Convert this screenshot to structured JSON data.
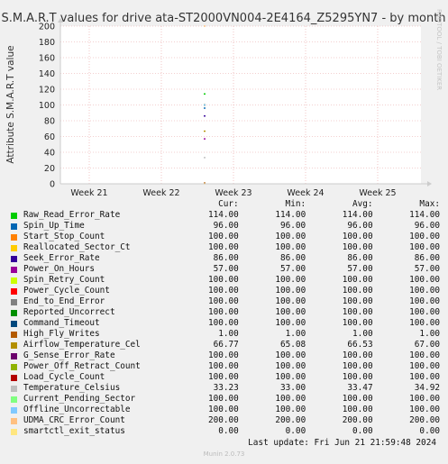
{
  "chart_data": {
    "type": "line",
    "title": "S.M.A.R.T values for drive ata-ST2000VN004-2E4164_Z5295YN7 - by month",
    "ylabel": "Attribute S.M.A.R.T value",
    "ylim": [
      0,
      200
    ],
    "yticks": [
      "0",
      "20",
      "40",
      "60",
      "80",
      "100",
      "120",
      "140",
      "160",
      "180",
      "200"
    ],
    "xlim": [
      20.6,
      25.6
    ],
    "xticks": [
      {
        "x": 21,
        "label": "Week 21"
      },
      {
        "x": 22,
        "label": "Week 22"
      },
      {
        "x": 23,
        "label": "Week 23"
      },
      {
        "x": 24,
        "label": "Week 24"
      },
      {
        "x": 25,
        "label": "Week 25"
      }
    ],
    "data_x": 22.6,
    "grid": true,
    "legend_position": "bottom",
    "side_label": "RRDTOOL / TOBI OETIKER",
    "columns": {
      "cur": "Cur:",
      "min": "Min:",
      "avg": "Avg:",
      "max": "Max:"
    },
    "series": [
      {
        "name": "Raw_Read_Error_Rate",
        "color": "#00cc00",
        "cur": "114.00",
        "min": "114.00",
        "avg": "114.00",
        "max": "114.00",
        "value": 114
      },
      {
        "name": "Spin_Up_Time",
        "color": "#0066b3",
        "cur": "96.00",
        "min": "96.00",
        "avg": "96.00",
        "max": "96.00",
        "value": 96
      },
      {
        "name": "Start_Stop_Count",
        "color": "#ff8000",
        "cur": "100.00",
        "min": "100.00",
        "avg": "100.00",
        "max": "100.00",
        "value": 100
      },
      {
        "name": "Reallocated_Sector_Ct",
        "color": "#ffcc00",
        "cur": "100.00",
        "min": "100.00",
        "avg": "100.00",
        "max": "100.00",
        "value": 100
      },
      {
        "name": "Seek_Error_Rate",
        "color": "#330099",
        "cur": "86.00",
        "min": "86.00",
        "avg": "86.00",
        "max": "86.00",
        "value": 86
      },
      {
        "name": "Power_On_Hours",
        "color": "#990099",
        "cur": "57.00",
        "min": "57.00",
        "avg": "57.00",
        "max": "57.00",
        "value": 57
      },
      {
        "name": "Spin_Retry_Count",
        "color": "#ccff00",
        "cur": "100.00",
        "min": "100.00",
        "avg": "100.00",
        "max": "100.00",
        "value": 100
      },
      {
        "name": "Power_Cycle_Count",
        "color": "#ff0000",
        "cur": "100.00",
        "min": "100.00",
        "avg": "100.00",
        "max": "100.00",
        "value": 100
      },
      {
        "name": "End_to_End_Error",
        "color": "#808080",
        "cur": "100.00",
        "min": "100.00",
        "avg": "100.00",
        "max": "100.00",
        "value": 100
      },
      {
        "name": "Reported_Uncorrect",
        "color": "#008f00",
        "cur": "100.00",
        "min": "100.00",
        "avg": "100.00",
        "max": "100.00",
        "value": 100
      },
      {
        "name": "Command_Timeout",
        "color": "#00487d",
        "cur": "100.00",
        "min": "100.00",
        "avg": "100.00",
        "max": "100.00",
        "value": 100
      },
      {
        "name": "High_Fly_Writes",
        "color": "#b35a00",
        "cur": "1.00",
        "min": "1.00",
        "avg": "1.00",
        "max": "1.00",
        "value": 1
      },
      {
        "name": "Airflow_Temperature_Cel",
        "color": "#b38f00",
        "cur": "66.77",
        "min": "65.08",
        "avg": "66.53",
        "max": "67.00",
        "value": 66.77
      },
      {
        "name": "G_Sense_Error_Rate",
        "color": "#6b006b",
        "cur": "100.00",
        "min": "100.00",
        "avg": "100.00",
        "max": "100.00",
        "value": 100
      },
      {
        "name": "Power_Off_Retract_Count",
        "color": "#8fb300",
        "cur": "100.00",
        "min": "100.00",
        "avg": "100.00",
        "max": "100.00",
        "value": 100
      },
      {
        "name": "Load_Cycle_Count",
        "color": "#b30000",
        "cur": "100.00",
        "min": "100.00",
        "avg": "100.00",
        "max": "100.00",
        "value": 100
      },
      {
        "name": "Temperature_Celsius",
        "color": "#bebebe",
        "cur": "33.23",
        "min": "33.00",
        "avg": "33.47",
        "max": "34.92",
        "value": 33.23
      },
      {
        "name": "Current_Pending_Sector",
        "color": "#80ff80",
        "cur": "100.00",
        "min": "100.00",
        "avg": "100.00",
        "max": "100.00",
        "value": 100
      },
      {
        "name": "Offline_Uncorrectable",
        "color": "#80c9ff",
        "cur": "100.00",
        "min": "100.00",
        "avg": "100.00",
        "max": "100.00",
        "value": 100
      },
      {
        "name": "UDMA_CRC_Error_Count",
        "color": "#ffc080",
        "cur": "200.00",
        "min": "200.00",
        "avg": "200.00",
        "max": "200.00",
        "value": 200
      },
      {
        "name": "smartctl_exit_status",
        "color": "#ffe680",
        "cur": "0.00",
        "min": "0.00",
        "avg": "0.00",
        "max": "0.00",
        "value": 0
      }
    ]
  },
  "last_update": "Last update: Fri Jun 21 21:59:48 2024",
  "footer": "Munin 2.0.73"
}
